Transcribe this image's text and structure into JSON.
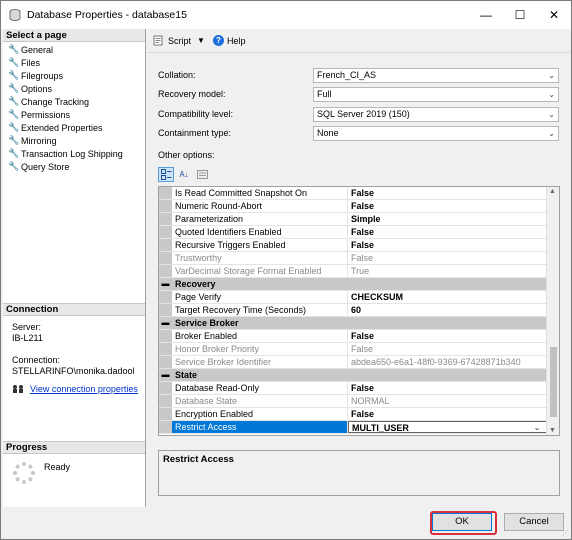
{
  "window": {
    "title": "Database Properties - database15"
  },
  "select_page": {
    "header": "Select a page",
    "items": [
      "General",
      "Files",
      "Filegroups",
      "Options",
      "Change Tracking",
      "Permissions",
      "Extended Properties",
      "Mirroring",
      "Transaction Log Shipping",
      "Query Store"
    ]
  },
  "connection": {
    "header": "Connection",
    "server_label": "Server:",
    "server_value": "IB-L211",
    "connection_label": "Connection:",
    "connection_value": "STELLARINFO\\monika.dadool",
    "view_link": "View connection properties"
  },
  "progress": {
    "header": "Progress",
    "status": "Ready"
  },
  "toolbar": {
    "script_label": "Script",
    "help_label": "Help"
  },
  "form": {
    "collation_label": "Collation:",
    "collation_value": "French_CI_AS",
    "recovery_label": "Recovery model:",
    "recovery_value": "Full",
    "compat_label": "Compatibility level:",
    "compat_value": "SQL Server 2019 (150)",
    "containment_label": "Containment type:",
    "containment_value": "None",
    "other_options_label": "Other options:"
  },
  "grid": {
    "rows": [
      {
        "name": "Is Read Committed Snapshot On",
        "value": "False"
      },
      {
        "name": "Numeric Round-Abort",
        "value": "False"
      },
      {
        "name": "Parameterization",
        "value": "Simple"
      },
      {
        "name": "Quoted Identifiers Enabled",
        "value": "False"
      },
      {
        "name": "Recursive Triggers Enabled",
        "value": "False"
      },
      {
        "name": "Trustworthy",
        "value": "False"
      },
      {
        "name": "VarDecimal Storage Format Enabled",
        "value": "True"
      },
      {
        "name": "Recovery",
        "value": ""
      },
      {
        "name": "Page Verify",
        "value": "CHECKSUM"
      },
      {
        "name": "Target Recovery Time (Seconds)",
        "value": "60"
      },
      {
        "name": "Service Broker",
        "value": ""
      },
      {
        "name": "Broker Enabled",
        "value": "False"
      },
      {
        "name": "Honor Broker Priority",
        "value": "False"
      },
      {
        "name": "Service Broker Identifier",
        "value": "abdea650-e6a1-48f0-9369-67428871b340"
      },
      {
        "name": "State",
        "value": ""
      },
      {
        "name": "Database Read-Only",
        "value": "False"
      },
      {
        "name": "Database State",
        "value": "NORMAL"
      },
      {
        "name": "Encryption Enabled",
        "value": "False"
      },
      {
        "name": "Restrict Access",
        "value": "MULTI_USER"
      }
    ]
  },
  "description": {
    "title": "Restrict Access"
  },
  "buttons": {
    "ok": "OK",
    "cancel": "Cancel"
  },
  "colors": {
    "selection": "#0078d7",
    "ok_highlight": "#d9303e",
    "link": "#0033cc"
  }
}
